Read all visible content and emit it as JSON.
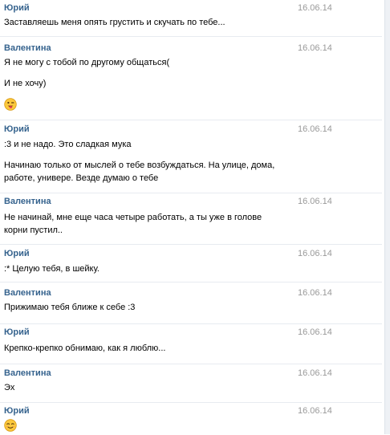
{
  "colors": {
    "author": "#36638e",
    "date": "#999999",
    "text": "#000000",
    "separator": "#e7ebf0"
  },
  "messages": [
    {
      "author": "Юрий",
      "date": "16.06.14",
      "lines": [
        "Заставляешь меня опять грустить и скучать по тебе..."
      ]
    },
    {
      "author": "Валентина",
      "date": "16.06.14",
      "lines": [
        "Я не могу с тобой по другому общаться(",
        "И не хочу)"
      ],
      "emoji": "winking-tongue-smiley-icon"
    },
    {
      "author": "Юрий",
      "date": "16.06.14",
      "lines": [
        ":3 и не надо. Это сладкая мука",
        "Начинаю только от мыслей о тебе возбуждаться. На улице, дома,",
        "работе, универе. Везде думаю о тебе"
      ]
    },
    {
      "author": "Валентина",
      "date": "16.06.14",
      "lines": [
        "Не начинай, мне еще часа четыре работать, а ты уже в голове",
        "корни пустил.."
      ]
    },
    {
      "author": "Юрий",
      "date": "16.06.14",
      "lines": [
        ":* Целую тебя, в шейку."
      ]
    },
    {
      "author": "Валентина",
      "date": "16.06.14",
      "lines": [
        "Прижимаю тебя ближе к себе :3"
      ]
    },
    {
      "author": "Юрий",
      "date": "16.06.14",
      "lines": [
        "Крепко-крепко обнимаю, как я люблю..."
      ]
    },
    {
      "author": "Валентина",
      "date": "16.06.14",
      "lines": [
        "Эх"
      ]
    },
    {
      "author": "Юрий",
      "date": "16.06.14",
      "lines": [],
      "emoji": "content-smiley-icon"
    }
  ]
}
